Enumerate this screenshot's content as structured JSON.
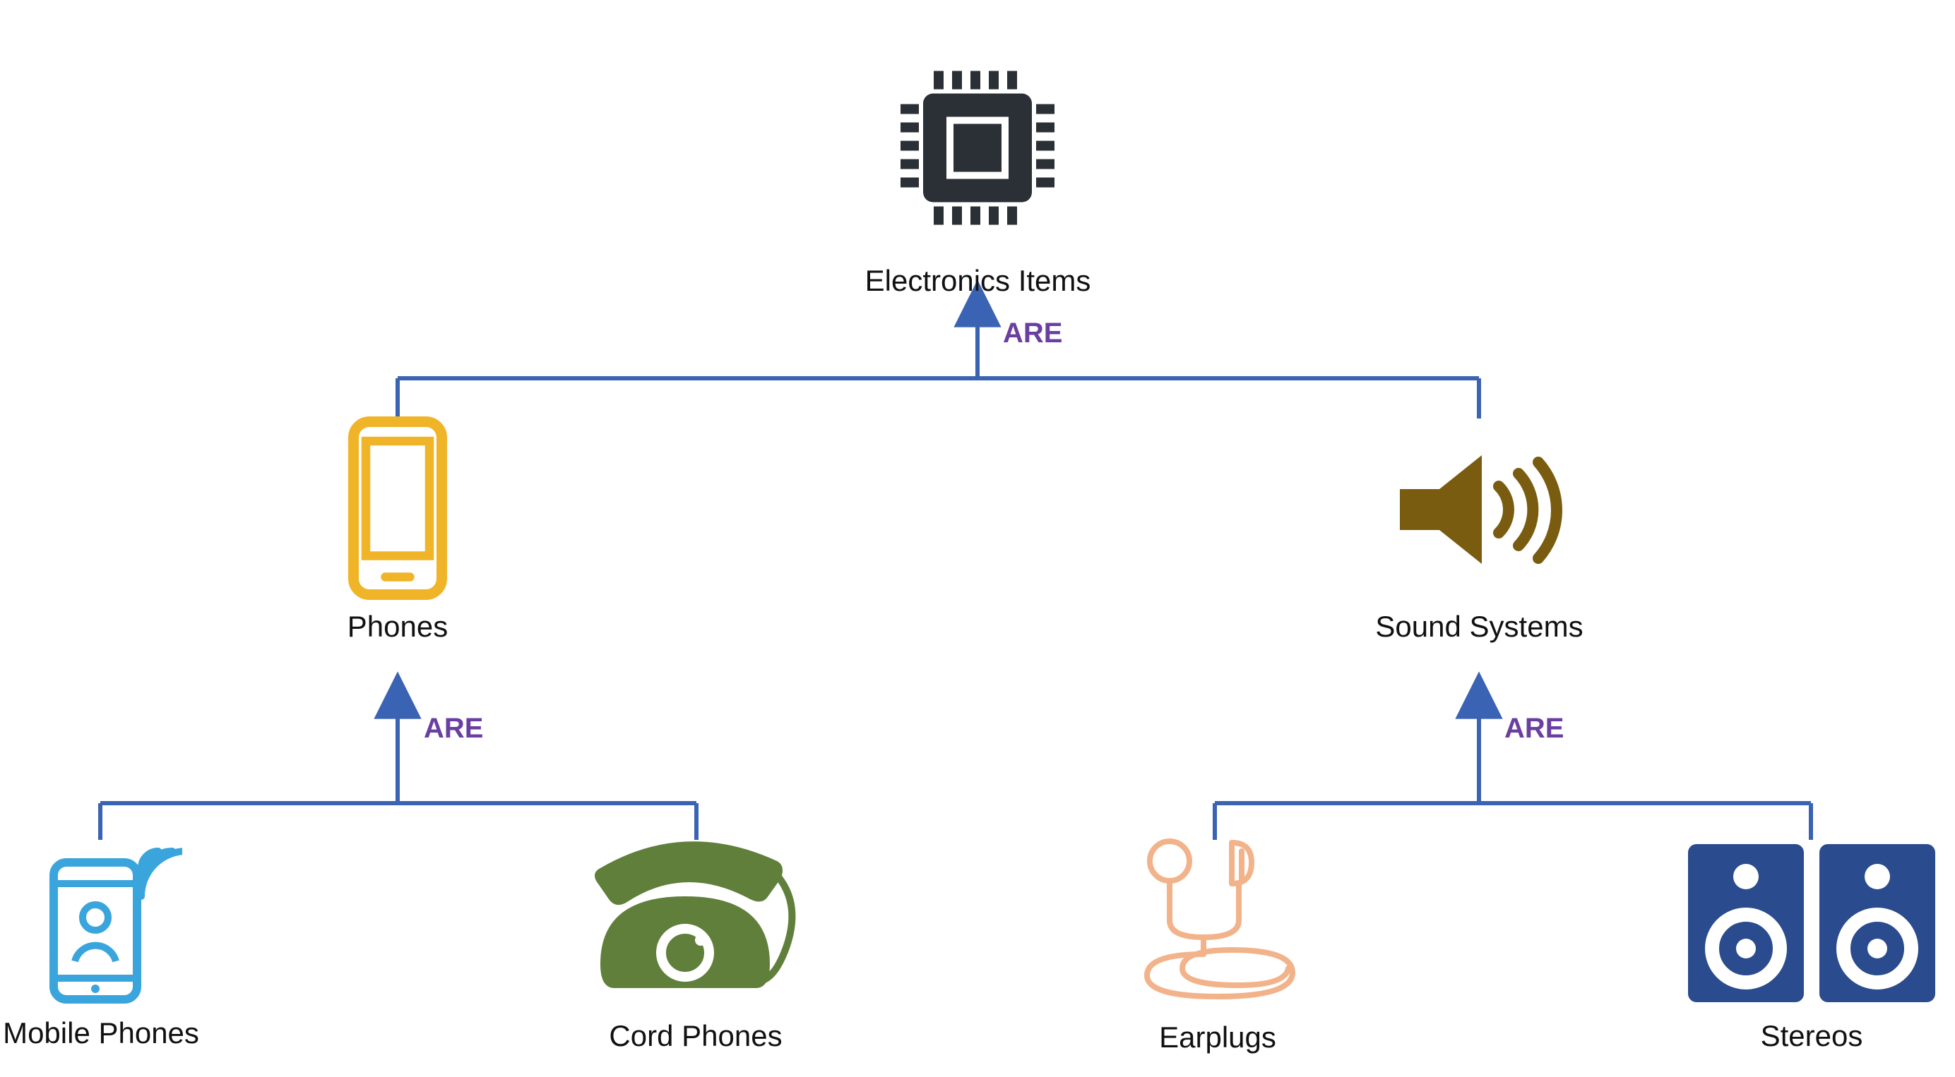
{
  "colors": {
    "connector": "#3b63b3",
    "edge_label": "#6a3fa0",
    "chip": "#2b2f36",
    "smartphone": "#f0b429",
    "speaker": "#7a5c10",
    "mobile": "#3aa5dc",
    "cord_phone": "#5f7f3b",
    "earplugs": "#f2b38a",
    "stereo": "#2a4b8d"
  },
  "nodes": {
    "root": {
      "id": "electronics",
      "label": "Electronics Items",
      "icon": "chip-icon"
    },
    "mid": [
      {
        "id": "phones",
        "label": "Phones",
        "icon": "smartphone-yellow-icon"
      },
      {
        "id": "sound_systems",
        "label": "Sound Systems",
        "icon": "speaker-brown-icon"
      }
    ],
    "leaves": [
      {
        "id": "mobile_phones",
        "label": "Mobile Phones",
        "icon": "mobile-blue-icon",
        "parent": "phones"
      },
      {
        "id": "cord_phones",
        "label": "Cord Phones",
        "icon": "cord-phone-icon",
        "parent": "phones"
      },
      {
        "id": "earplugs",
        "label": "Earplugs",
        "icon": "earplugs-icon",
        "parent": "sound_systems"
      },
      {
        "id": "stereos",
        "label": "Stereos",
        "icon": "stereo-icon",
        "parent": "sound_systems"
      }
    ]
  },
  "edge_labels": {
    "root_children": "ARE",
    "phones_children": "ARE",
    "sound_children": "ARE"
  }
}
